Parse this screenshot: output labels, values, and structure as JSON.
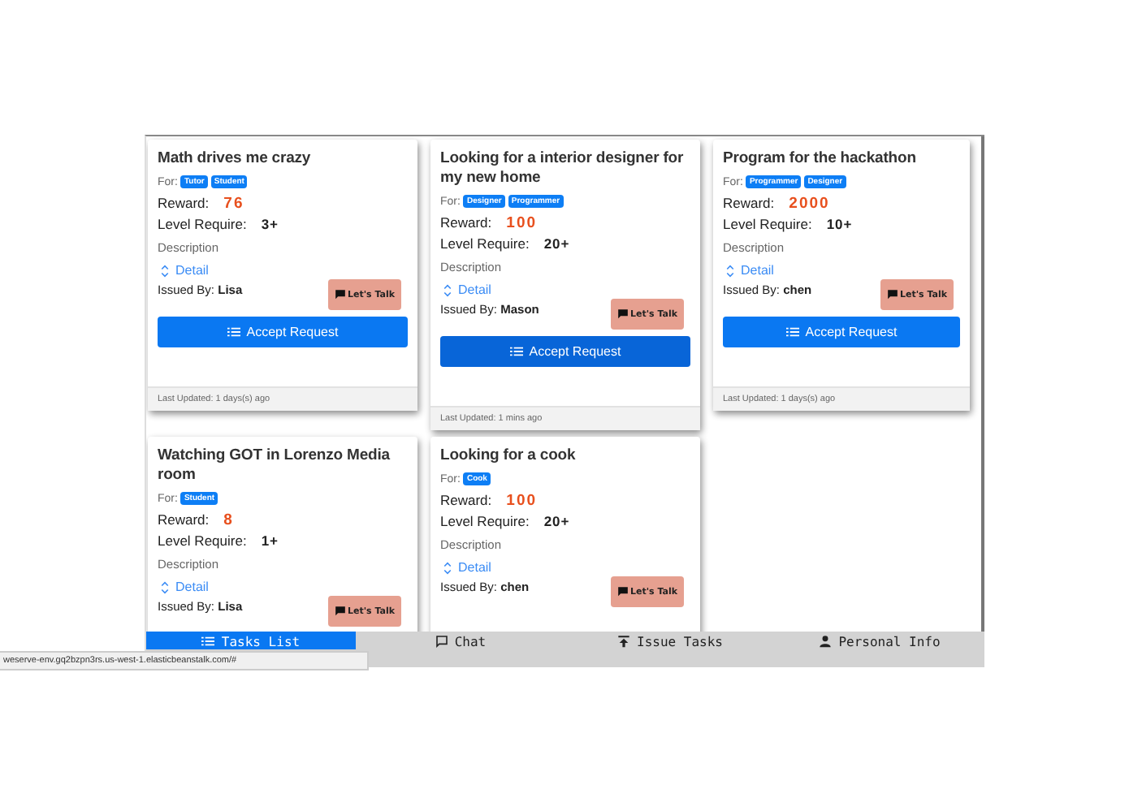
{
  "cards": [
    {
      "title": "Math drives me crazy",
      "for_label": "For:",
      "tags": [
        "Tutor",
        "Student"
      ],
      "reward_label": "Reward:",
      "reward": "76",
      "level_label": "Level Require:",
      "level_value": "3+",
      "description_label": "Description",
      "detail_label": "Detail",
      "issued_label": "Issued By:",
      "issuer": "Lisa",
      "talk_label": "Let's Talk",
      "accept_label": "Accept Request",
      "updated": "Last Updated: 1 days(s) ago"
    },
    {
      "title": "Looking for a interior designer for my new home",
      "for_label": "For:",
      "tags": [
        "Designer",
        "Programmer"
      ],
      "reward_label": "Reward:",
      "reward": "100",
      "level_label": "Level Require:",
      "level_value": "20+",
      "description_label": "Description",
      "detail_label": "Detail",
      "issued_label": "Issued By:",
      "issuer": "Mason",
      "talk_label": "Let's Talk",
      "accept_label": "Accept Request",
      "updated": "Last Updated: 1 mins ago"
    },
    {
      "title": "Program for the hackathon",
      "for_label": "For:",
      "tags": [
        "Programmer",
        "Designer"
      ],
      "reward_label": "Reward:",
      "reward": "2000",
      "level_label": "Level Require:",
      "level_value": "10+",
      "description_label": "Description",
      "detail_label": "Detail",
      "issued_label": "Issued By:",
      "issuer": "chen",
      "talk_label": "Let's Talk",
      "accept_label": "Accept Request",
      "updated": "Last Updated: 1 days(s) ago"
    },
    {
      "title": "Watching GOT in Lorenzo Media room",
      "for_label": "For:",
      "tags": [
        "Student"
      ],
      "reward_label": "Reward:",
      "reward": "8",
      "level_label": "Level Require:",
      "level_value": "1+",
      "description_label": "Description",
      "detail_label": "Detail",
      "issued_label": "Issued By:",
      "issuer": "Lisa",
      "talk_label": "Let's Talk"
    },
    {
      "title": "Looking for a cook",
      "for_label": "For:",
      "tags": [
        "Cook"
      ],
      "reward_label": "Reward:",
      "reward": "100",
      "level_label": "Level Require:",
      "level_value": "20+",
      "description_label": "Description",
      "detail_label": "Detail",
      "issued_label": "Issued By:",
      "issuer": "chen",
      "talk_label": "Let's Talk"
    }
  ],
  "nav": [
    {
      "label": "Tasks List",
      "kind": "list",
      "selected": true
    },
    {
      "label": "Chat",
      "kind": "chat",
      "selected": false
    },
    {
      "label": "Issue Tasks",
      "kind": "upload",
      "selected": false
    },
    {
      "label": "Personal Info",
      "kind": "person",
      "selected": false
    }
  ],
  "status_bar": "weserve-env.gq2bzpn3rs.us-west-1.elasticbeanstalk.com/#"
}
